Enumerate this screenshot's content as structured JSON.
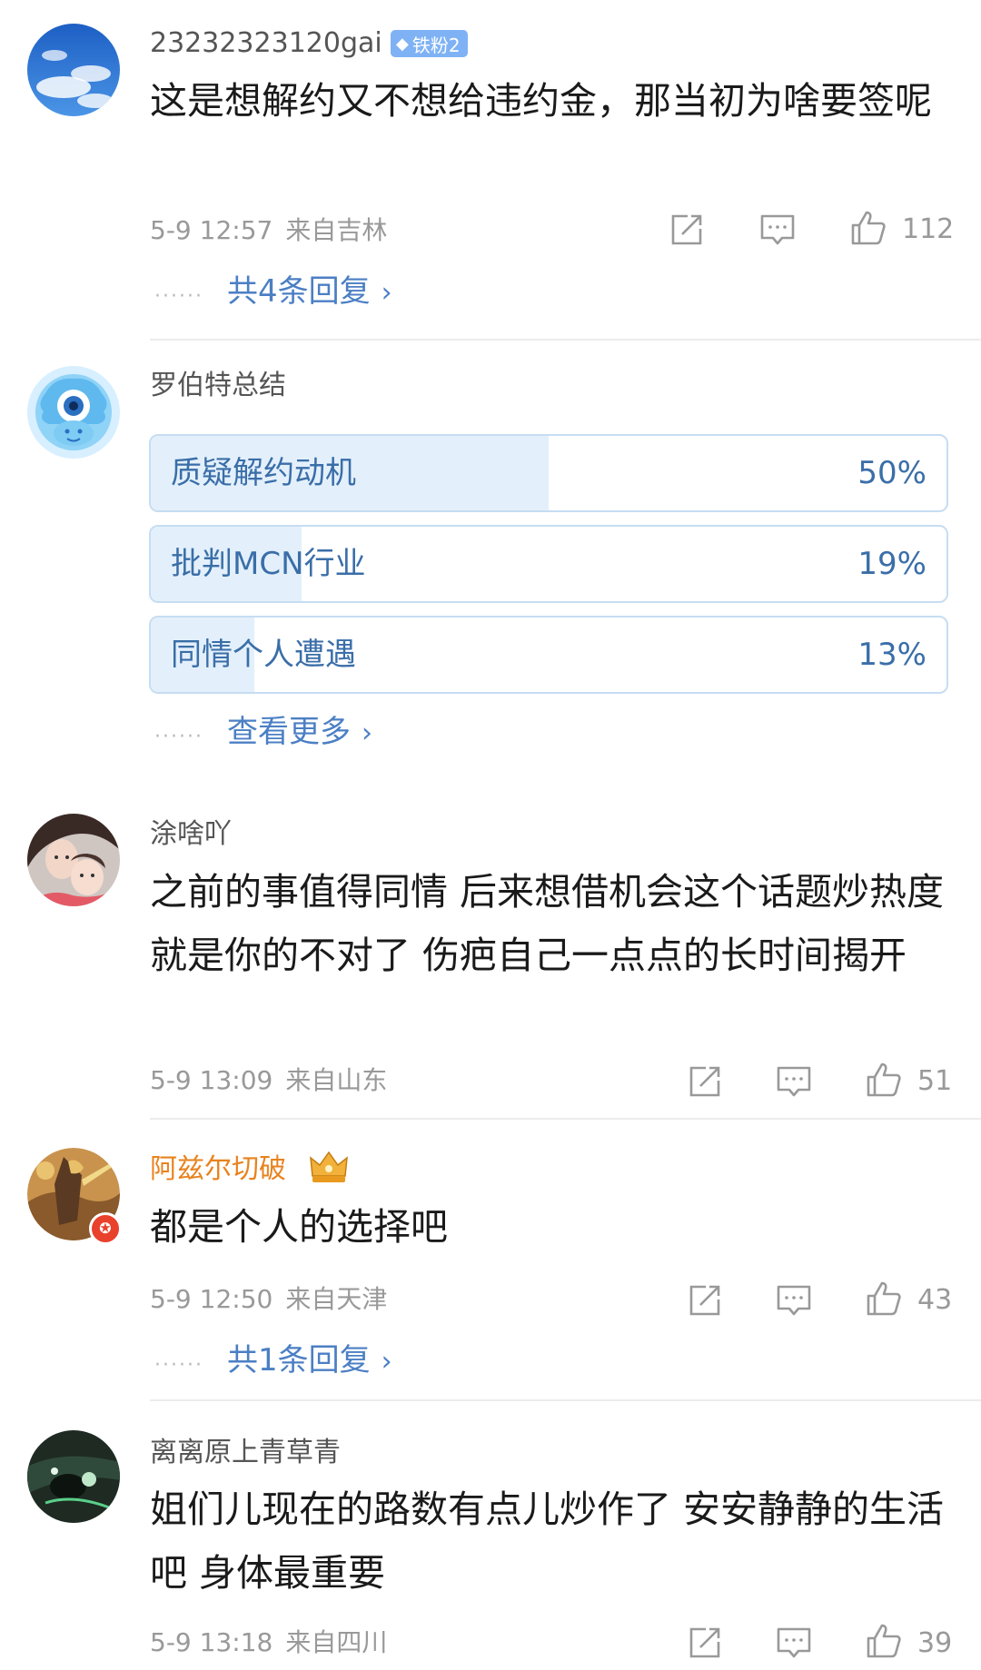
{
  "comments": [
    {
      "username": "23232323120gai",
      "fan_badge": "铁粉2",
      "text": "这是想解约又不想给违约金，那当初为啥要签呢",
      "time": "5-9 12:57",
      "location": "来自吉林",
      "likes": "112",
      "replies": "共4条回复"
    },
    {
      "username": "涂啥吖",
      "text": "之前的事值得同情 后来想借机会这个话题炒热度就是你的不对了 伤疤自己一点点的长时间揭开",
      "time": "5-9 13:09",
      "location": "来自山东",
      "likes": "51"
    },
    {
      "username": "阿兹尔切破",
      "text": "都是个人的选择吧",
      "time": "5-9 12:50",
      "location": "来自天津",
      "likes": "43",
      "replies": "共1条回复"
    },
    {
      "username": "离离原上青草青",
      "text": "姐们儿现在的路数有点儿炒作了  安安静静的生活吧 身体最重要",
      "time": "5-9 13:18",
      "location": "来自四川",
      "likes": "39"
    }
  ],
  "summary": {
    "username": "罗伯特总结",
    "options": [
      {
        "label": "质疑解约动机",
        "percent_text": "50%",
        "percent": 50
      },
      {
        "label": "批判MCN行业",
        "percent_text": "19%",
        "percent": 19
      },
      {
        "label": "同情个人遭遇",
        "percent_text": "13%",
        "percent": 13
      }
    ],
    "more": "查看更多"
  },
  "ui": {
    "dots": "······",
    "chevron": "›"
  },
  "colors": {
    "link": "#4b7fc4",
    "poll_fill": "#e3f0fb",
    "gold_name": "#e8821e"
  }
}
